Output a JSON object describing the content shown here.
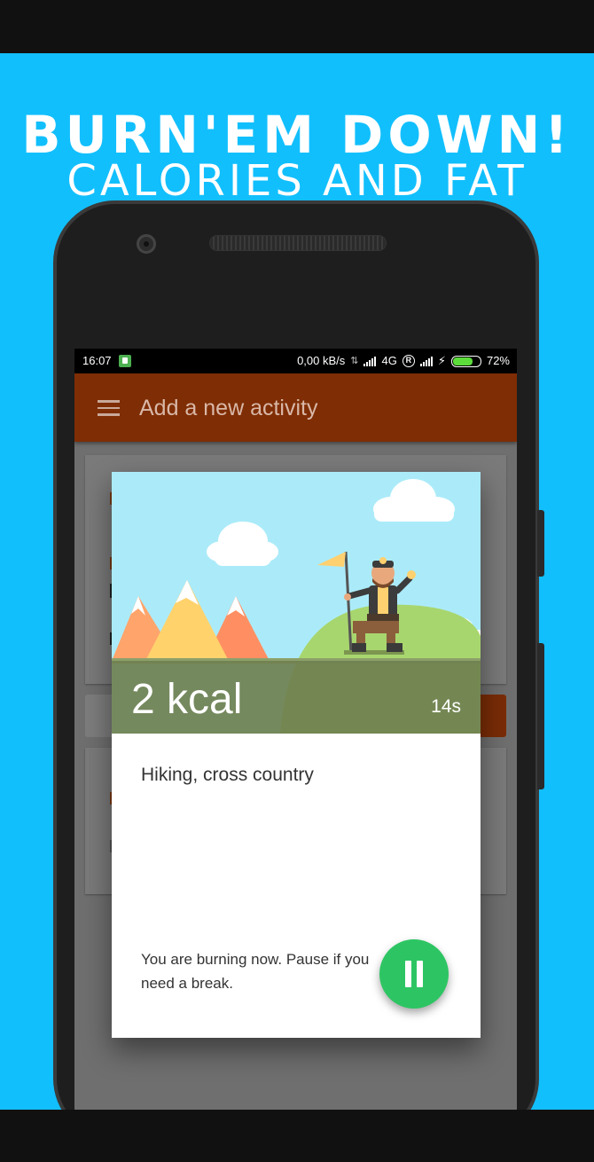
{
  "promo": {
    "headline": "BURN'EM DOWN!",
    "subline": "CALORIES AND FAT",
    "background_color": "#12BFFD"
  },
  "status_bar": {
    "time": "16:07",
    "network_speed": "0,00 kB/s",
    "network_type": "4G",
    "roaming": "R",
    "battery": "72%"
  },
  "app_bar": {
    "menu_icon": "hamburger-menu-icon",
    "title": "Add a new activity",
    "color": "#7F2D04"
  },
  "dialog": {
    "kcal": "2 kcal",
    "elapsed": "14s",
    "activity": "Hiking, cross country",
    "hint": "You are burning now. Pause if you need a break.",
    "pause_icon": "pause-icon",
    "accent_color": "#2DC563"
  }
}
